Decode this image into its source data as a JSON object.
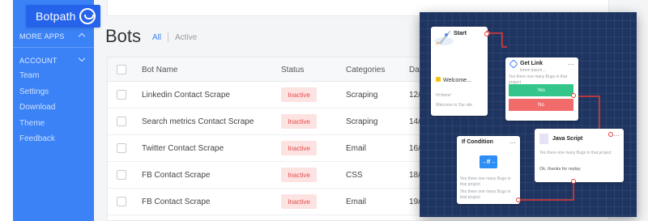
{
  "brand": {
    "name": "Botpath"
  },
  "sidebar": {
    "more_apps": "MORE APPS",
    "account": "ACCOUNT",
    "items": [
      {
        "label": "Team"
      },
      {
        "label": "Settings"
      },
      {
        "label": "Download"
      },
      {
        "label": "Theme"
      },
      {
        "label": "Feedback"
      }
    ]
  },
  "page": {
    "title": "Bots",
    "filters": {
      "all": "All",
      "active": "Active"
    }
  },
  "table": {
    "headers": {
      "name": "Bot Name",
      "status": "Status",
      "categories": "Categories",
      "date": "Dat"
    },
    "rows": [
      {
        "name": "Linkedin Contact Scrape",
        "status": "Inactive",
        "category": "Scraping",
        "date": "12/"
      },
      {
        "name": "Search metrics Contact Scrape",
        "status": "Inactive",
        "category": "Scraping",
        "date": "14/"
      },
      {
        "name": "Twitter Contact Scrape",
        "status": "Inactive",
        "category": "Email",
        "date": "16/"
      },
      {
        "name": "FB Contact Scrape",
        "status": "Inactive",
        "category": "CSS",
        "date": "18/"
      },
      {
        "name": "FB Contact Scrape",
        "status": "Inactive",
        "category": "Email",
        "date": "19/"
      }
    ]
  },
  "flow": {
    "start": {
      "title": "Start",
      "welcome": "Welcome...",
      "hi": "Hi there!",
      "msg": "Welcome to Our site"
    },
    "getlink": {
      "title": "Get Link",
      "sub": "lorem ipsum...",
      "text": "Yes there one many Bugs in that project",
      "yes": "Yes",
      "no": "No"
    },
    "ifcond": {
      "title": "If Condition",
      "icon": "→If→",
      "text1": "Yes there one many Bugs in that project",
      "text2": "Yes there one many Bugs in that project"
    },
    "java": {
      "title": "Java Script",
      "text": "Yes there one many Bugs in that project",
      "reply": "Ok, thanks for replay"
    }
  },
  "colors": {
    "sidebar": "#3b82f6",
    "brand": "#2563eb",
    "inactive_bg": "#fde2e2",
    "inactive_text": "#e24c4c",
    "canvas": "#1f3561",
    "yes": "#34c58a",
    "no": "#f26b6b",
    "connector": "#e53935"
  }
}
